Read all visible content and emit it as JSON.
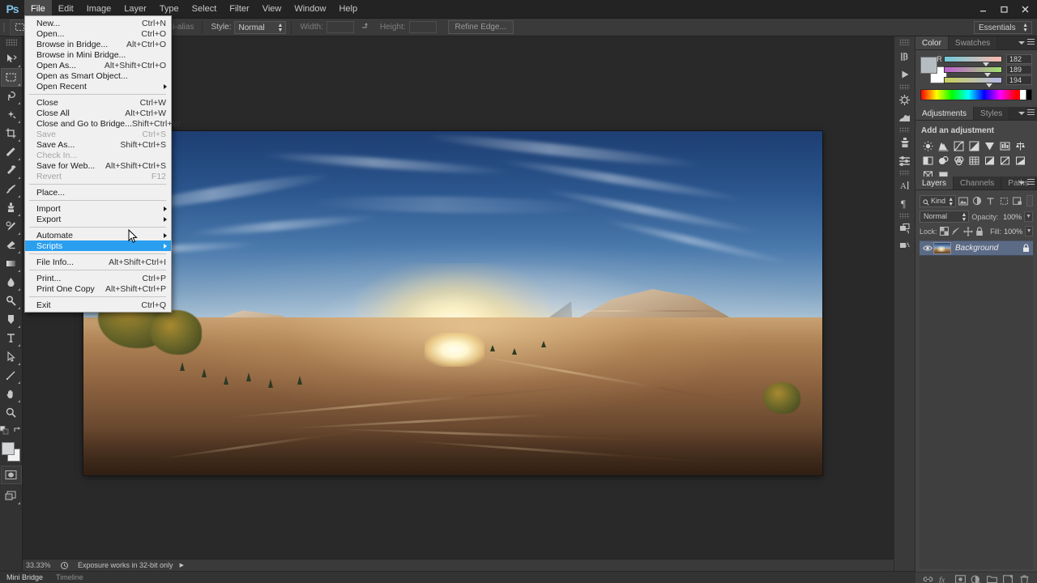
{
  "app": {
    "logo": "Ps",
    "workspace": "Essentials"
  },
  "menubar": {
    "items": [
      {
        "label": "File",
        "active": true
      },
      {
        "label": "Edit",
        "active": false
      },
      {
        "label": "Image",
        "active": false
      },
      {
        "label": "Layer",
        "active": false
      },
      {
        "label": "Type",
        "active": false
      },
      {
        "label": "Select",
        "active": false
      },
      {
        "label": "Filter",
        "active": false
      },
      {
        "label": "View",
        "active": false
      },
      {
        "label": "Window",
        "active": false
      },
      {
        "label": "Help",
        "active": false
      }
    ]
  },
  "window_controls": {
    "minimize": "minimize-icon",
    "maximize": "maximize-icon",
    "close": "close-icon"
  },
  "options_bar": {
    "anti_alias_label": "nti-alias",
    "style_label": "Style:",
    "style_value": "Normal",
    "width_label": "Width:",
    "width_value": "",
    "swap_icon": "swap-dimensions-icon",
    "height_label": "Height:",
    "height_value": "",
    "refine_edge_label": "Refine Edge..."
  },
  "file_menu": {
    "groups": [
      [
        {
          "label": "New...",
          "accel": "Ctrl+N",
          "mnemonic": "N"
        },
        {
          "label": "Open...",
          "accel": "Ctrl+O",
          "mnemonic": "O"
        },
        {
          "label": "Browse in Bridge...",
          "accel": "Alt+Ctrl+O",
          "mnemonic": "B"
        },
        {
          "label": "Browse in Mini Bridge...",
          "accel": "",
          "mnemonic": "g"
        },
        {
          "label": "Open As...",
          "accel": "Alt+Shift+Ctrl+O",
          "mnemonic": "A"
        },
        {
          "label": "Open as Smart Object...",
          "accel": "",
          "mnemonic": ""
        },
        {
          "label": "Open Recent",
          "accel": "",
          "submenu": true,
          "mnemonic": ""
        }
      ],
      [
        {
          "label": "Close",
          "accel": "Ctrl+W",
          "mnemonic": "C"
        },
        {
          "label": "Close All",
          "accel": "Alt+Ctrl+W",
          "mnemonic": ""
        },
        {
          "label": "Close and Go to Bridge...",
          "accel": "Shift+Ctrl+W",
          "mnemonic": ""
        },
        {
          "label": "Save",
          "accel": "Ctrl+S",
          "disabled": true
        },
        {
          "label": "Save As...",
          "accel": "Shift+Ctrl+S",
          "mnemonic": "A"
        },
        {
          "label": "Check In...",
          "accel": "",
          "disabled": true
        },
        {
          "label": "Save for Web...",
          "accel": "Alt+Shift+Ctrl+S",
          "mnemonic": ""
        },
        {
          "label": "Revert",
          "accel": "F12",
          "disabled": true
        }
      ],
      [
        {
          "label": "Place...",
          "accel": "",
          "mnemonic": "l"
        }
      ],
      [
        {
          "label": "Import",
          "accel": "",
          "submenu": true,
          "mnemonic": "m"
        },
        {
          "label": "Export",
          "accel": "",
          "submenu": true,
          "mnemonic": "E"
        }
      ],
      [
        {
          "label": "Automate",
          "accel": "",
          "submenu": true,
          "mnemonic": "u"
        },
        {
          "label": "Scripts",
          "accel": "",
          "submenu": true,
          "highlighted": true,
          "mnemonic": "c"
        }
      ],
      [
        {
          "label": "File Info...",
          "accel": "Alt+Shift+Ctrl+I",
          "mnemonic": "F"
        }
      ],
      [
        {
          "label": "Print...",
          "accel": "Ctrl+P",
          "mnemonic": "P"
        },
        {
          "label": "Print One Copy",
          "accel": "Alt+Shift+Ctrl+P",
          "mnemonic": ""
        }
      ],
      [
        {
          "label": "Exit",
          "accel": "Ctrl+Q",
          "mnemonic": "x"
        }
      ]
    ]
  },
  "toolbar": {
    "tools": [
      {
        "name": "move-tool",
        "selected": false
      },
      {
        "name": "rectangular-marquee-tool",
        "selected": true
      },
      {
        "name": "lasso-tool",
        "selected": false
      },
      {
        "name": "quick-selection-tool",
        "selected": false
      },
      {
        "name": "crop-tool",
        "selected": false
      },
      {
        "name": "eyedropper-tool",
        "selected": false
      },
      {
        "name": "spot-healing-brush-tool",
        "selected": false
      },
      {
        "name": "brush-tool",
        "selected": false
      },
      {
        "name": "clone-stamp-tool",
        "selected": false
      },
      {
        "name": "history-brush-tool",
        "selected": false
      },
      {
        "name": "eraser-tool",
        "selected": false
      },
      {
        "name": "gradient-tool",
        "selected": false
      },
      {
        "name": "blur-tool",
        "selected": false
      },
      {
        "name": "dodge-tool",
        "selected": false
      },
      {
        "name": "pen-tool",
        "selected": false
      },
      {
        "name": "horizontal-type-tool",
        "selected": false
      },
      {
        "name": "path-selection-tool",
        "selected": false
      },
      {
        "name": "line-shape-tool",
        "selected": false
      },
      {
        "name": "hand-tool",
        "selected": false
      },
      {
        "name": "zoom-tool",
        "selected": false
      }
    ],
    "foreground_color": "#d4d6d8",
    "background_color": "#f2f2f2",
    "quick_mask_name": "quick-mask-mode",
    "screen_mode_name": "screen-mode"
  },
  "color_panel": {
    "tabs": [
      {
        "label": "Color",
        "active": true
      },
      {
        "label": "Swatches",
        "active": false
      }
    ],
    "channels": [
      {
        "label": "R",
        "value": "182"
      },
      {
        "label": "G",
        "value": "189"
      },
      {
        "label": "B",
        "value": "194"
      }
    ]
  },
  "adjustments_panel": {
    "tabs": [
      {
        "label": "Adjustments",
        "active": true
      },
      {
        "label": "Styles",
        "active": false
      }
    ],
    "title": "Add an adjustment",
    "icons": [
      "brightness-contrast-icon",
      "levels-icon",
      "curves-icon",
      "exposure-icon",
      "vibrance-icon",
      "hue-saturation-icon",
      "color-balance-icon",
      "black-white-icon",
      "photo-filter-icon",
      "channel-mixer-icon",
      "color-lookup-icon",
      "invert-icon",
      "posterize-icon",
      "threshold-icon",
      "gradient-map-icon",
      "selective-color-icon"
    ]
  },
  "layers_panel": {
    "tabs": [
      {
        "label": "Layers",
        "active": true
      },
      {
        "label": "Channels",
        "active": false
      },
      {
        "label": "Paths",
        "active": false
      }
    ],
    "filter_kind": "Kind",
    "filter_icons": [
      "filter-pixel-icon",
      "filter-adjustment-icon",
      "filter-type-icon",
      "filter-shape-icon",
      "filter-smart-object-icon"
    ],
    "blend_mode": "Normal",
    "opacity_label": "Opacity:",
    "opacity_value": "100%",
    "lock_label": "Lock:",
    "lock_icons": [
      "lock-transparent-pixels-icon",
      "lock-image-pixels-icon",
      "lock-position-icon",
      "lock-all-icon"
    ],
    "fill_label": "Fill:",
    "fill_value": "100%",
    "layers": [
      {
        "name": "Background",
        "visible": true,
        "locked": true
      }
    ],
    "footer_buttons": [
      "link-layers-icon",
      "layer-style-fx-icon",
      "add-layer-mask-icon",
      "new-adjustment-layer-icon",
      "new-group-icon",
      "new-layer-icon",
      "delete-layer-icon"
    ]
  },
  "rail": {
    "icons": [
      "history-icon",
      "actions-play-icon",
      "brush-preset-icon",
      "brush-panel-icon",
      "clone-source-icon",
      "tool-preset-icon",
      "character-icon",
      "paragraph-icon",
      "layer-comps-icon",
      "notes-icon"
    ]
  },
  "status_bar": {
    "zoom": "33.33%",
    "doc_icon": "document-icon",
    "message": "Exposure works in 32-bit only",
    "expand_icon": "expand-arrow-icon"
  },
  "bottom_bar": {
    "tabs": [
      {
        "label": "Mini Bridge",
        "active": true
      },
      {
        "label": "Timeline",
        "active": false
      }
    ]
  },
  "canvas": {
    "image_description": "Panoramic desert canyon landscape at sunrise with sandstone mesas"
  }
}
